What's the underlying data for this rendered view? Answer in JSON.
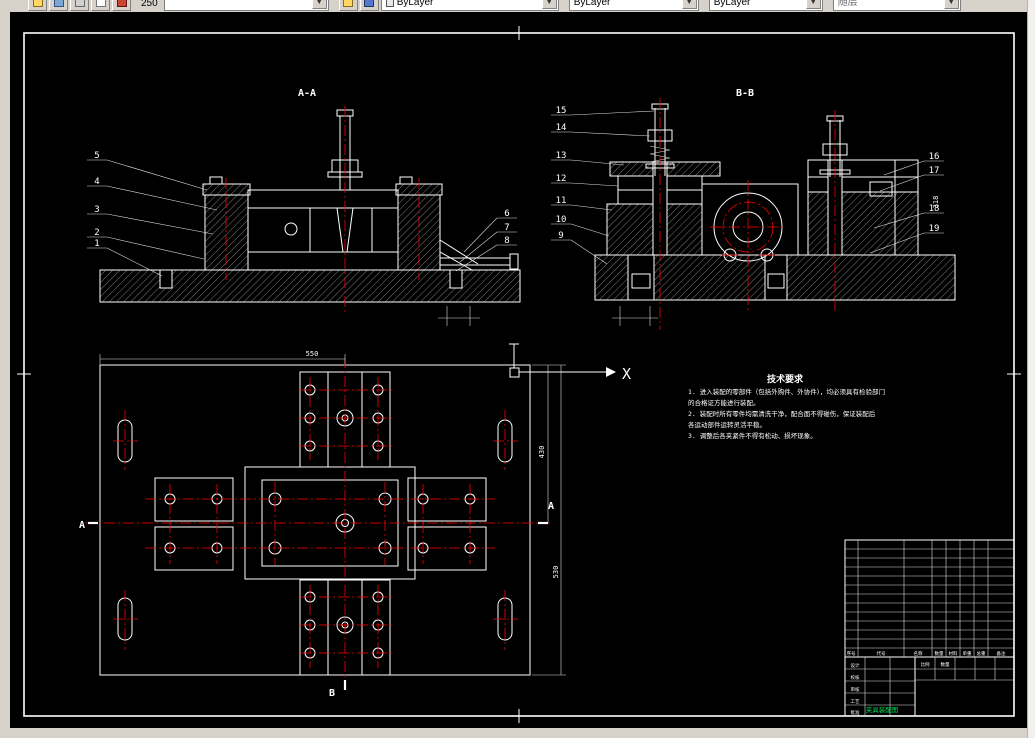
{
  "toolbar": {
    "zoom_value": "250",
    "layer_value": "",
    "color_value": "ByLayer",
    "linetype_value": "ByLayer",
    "lineweight_value": "ByLayer",
    "plotstyle_value": "随层"
  },
  "canvas": {
    "section_a": {
      "label": "A-A",
      "balloons_left": [
        "5",
        "4",
        "3",
        "2",
        "1"
      ],
      "balloons_right": [
        "6",
        "7",
        "8"
      ]
    },
    "section_b": {
      "label": "B-B",
      "balloons_left": [
        "15",
        "14",
        "13",
        "12",
        "11",
        "10",
        "9"
      ],
      "balloons_right": [
        "16",
        "17",
        "18",
        "19"
      ],
      "dim_side": "318"
    },
    "plan": {
      "axis_label": "X",
      "mark_a_left": "A",
      "mark_a_right": "A",
      "mark_b_bottom": "B",
      "dim_top": "550",
      "dim_right_inner": "430",
      "dim_right_outer": "530"
    },
    "tech": {
      "title": "技术要求",
      "lines": [
        "1. 进入装配的零部件（包括外购件、外协件），均必须具有检验部门",
        "   的合格证方能进行装配。",
        "2. 装配时所有零件均需清洗干净，配合面不得碰伤，保证装配后",
        "   各运动部件运转灵活平稳。",
        "3. 调整后各夹紧件不得有松动、损坏现象。"
      ]
    }
  },
  "title_block": {
    "header": [
      "序号",
      "代号",
      "名称",
      "数量",
      "材料",
      "单重",
      "总重",
      "备注"
    ],
    "sign_labels": [
      "设计",
      "校核",
      "审核",
      "工艺",
      "批准"
    ],
    "scale_label": "比例",
    "qty_label": "数量",
    "doc_name": "夹具装配图"
  }
}
